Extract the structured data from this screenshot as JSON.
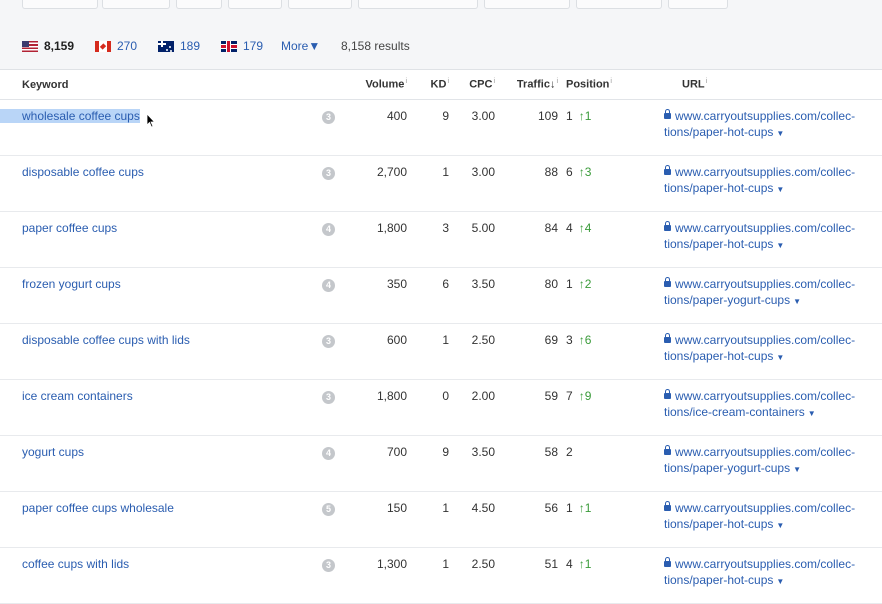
{
  "countries": [
    {
      "flag": "us-flag-icon",
      "count": "8,159"
    },
    {
      "flag": "ca-flag-icon",
      "count": "270"
    },
    {
      "flag": "au-flag-icon",
      "count": "189"
    },
    {
      "flag": "uk-flag-icon",
      "count": "179"
    }
  ],
  "more_label": "More",
  "results_text": "8,158 results",
  "columns": {
    "keyword": "Keyword",
    "volume": "Volume",
    "kd": "KD",
    "cpc": "CPC",
    "traffic": "Traffic",
    "traffic_sort": "↓",
    "position": "Position",
    "url": "URL",
    "info_glyph": "i"
  },
  "rows": [
    {
      "keyword": "wholesale coffee cups",
      "serp": "3",
      "volume": "400",
      "kd": "9",
      "cpc": "3.00",
      "traffic": "109",
      "position": "1",
      "change": "↑1",
      "url_line1": "www.carryoutsupplies.com/collec-",
      "url_line2": "tions/paper-hot-cups"
    },
    {
      "keyword": "disposable coffee cups",
      "serp": "3",
      "volume": "2,700",
      "kd": "1",
      "cpc": "3.00",
      "traffic": "88",
      "position": "6",
      "change": "↑3",
      "url_line1": "www.carryoutsupplies.com/collec-",
      "url_line2": "tions/paper-hot-cups"
    },
    {
      "keyword": "paper coffee cups",
      "serp": "4",
      "volume": "1,800",
      "kd": "3",
      "cpc": "5.00",
      "traffic": "84",
      "position": "4",
      "change": "↑4",
      "url_line1": "www.carryoutsupplies.com/collec-",
      "url_line2": "tions/paper-hot-cups"
    },
    {
      "keyword": "frozen yogurt cups",
      "serp": "4",
      "volume": "350",
      "kd": "6",
      "cpc": "3.50",
      "traffic": "80",
      "position": "1",
      "change": "↑2",
      "url_line1": "www.carryoutsupplies.com/collec-",
      "url_line2": "tions/paper-yogurt-cups"
    },
    {
      "keyword": "disposable coffee cups with lids",
      "serp": "3",
      "volume": "600",
      "kd": "1",
      "cpc": "2.50",
      "traffic": "69",
      "position": "3",
      "change": "↑6",
      "url_line1": "www.carryoutsupplies.com/collec-",
      "url_line2": "tions/paper-hot-cups"
    },
    {
      "keyword": "ice cream containers",
      "serp": "3",
      "volume": "1,800",
      "kd": "0",
      "cpc": "2.00",
      "traffic": "59",
      "position": "7",
      "change": "↑9",
      "url_line1": "www.carryoutsupplies.com/collec-",
      "url_line2": "tions/ice-cream-containers"
    },
    {
      "keyword": "yogurt cups",
      "serp": "4",
      "volume": "700",
      "kd": "9",
      "cpc": "3.50",
      "traffic": "58",
      "position": "2",
      "change": "",
      "url_line1": "www.carryoutsupplies.com/collec-",
      "url_line2": "tions/paper-yogurt-cups"
    },
    {
      "keyword": "paper coffee cups wholesale",
      "serp": "5",
      "volume": "150",
      "kd": "1",
      "cpc": "4.50",
      "traffic": "56",
      "position": "1",
      "change": "↑1",
      "url_line1": "www.carryoutsupplies.com/collec-",
      "url_line2": "tions/paper-hot-cups"
    },
    {
      "keyword": "coffee cups with lids",
      "serp": "3",
      "volume": "1,300",
      "kd": "1",
      "cpc": "2.50",
      "traffic": "51",
      "position": "4",
      "change": "↑1",
      "url_line1": "www.carryoutsupplies.com/collec-",
      "url_line2": "tions/paper-hot-cups"
    }
  ],
  "colors": {
    "link": "#2a5db0",
    "up": "#3a9b3a",
    "selection": "#b9d5f7"
  }
}
